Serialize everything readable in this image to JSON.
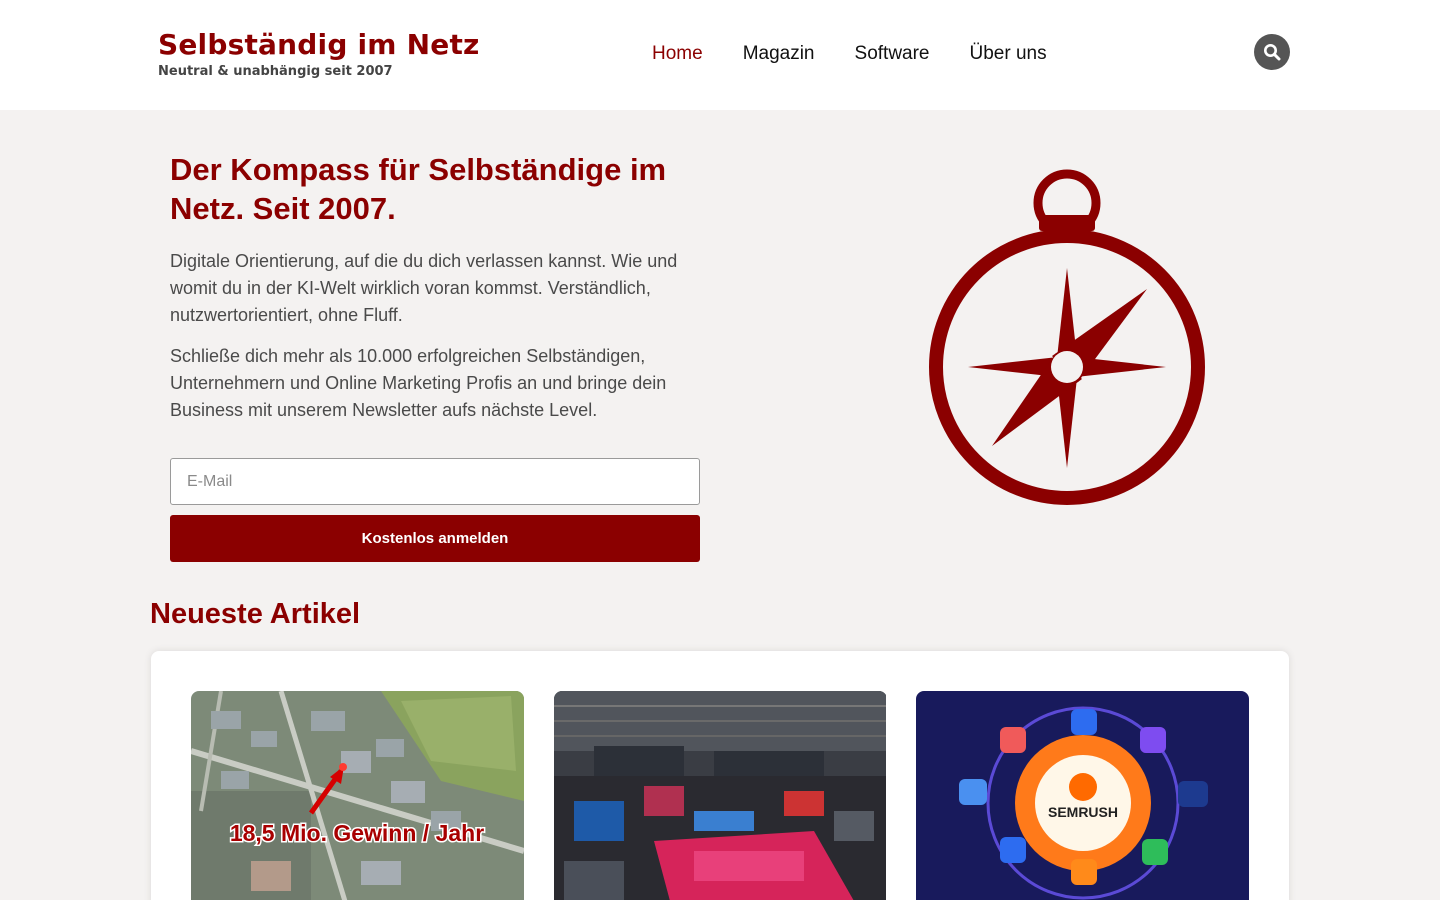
{
  "header": {
    "logo_title": "Selbständig im Netz",
    "logo_subtitle": "Neutral & unabhängig seit 2007",
    "nav": [
      {
        "label": "Home",
        "active": true
      },
      {
        "label": "Magazin",
        "active": false
      },
      {
        "label": "Software",
        "active": false
      },
      {
        "label": "Über uns",
        "active": false
      }
    ],
    "search_icon": "search-icon"
  },
  "hero": {
    "title": "Der Kompass für Selbständige im Netz. Seit 2007.",
    "paragraph1": "Digitale Orientierung, auf die du dich verlassen kannst. Wie und womit du in der KI-Welt wirklich voran kommst. Verständlich, nutzwertorientiert, ohne Fluff.",
    "paragraph2": "Schließe dich mehr als 10.000 erfolgreichen Selbständigen, Unternehmern und Online Marketing Profis an und bringe dein Business mit unserem Newsletter aufs nächste Level.",
    "email_placeholder": "E-Mail",
    "email_value": "",
    "submit_label": "Kostenlos anmelden",
    "illustration_icon": "compass-icon"
  },
  "articles": {
    "section_title": "Neueste Artikel",
    "items": [
      {
        "image_caption": "18,5 Mio. Gewinn / Jahr"
      },
      {
        "image_caption": ""
      },
      {
        "image_caption": "SEMRUSH"
      }
    ]
  },
  "colors": {
    "brand": "#8b0000",
    "background": "#f4f2f1",
    "header_bg": "#ffffff",
    "search_button": "#555555"
  }
}
